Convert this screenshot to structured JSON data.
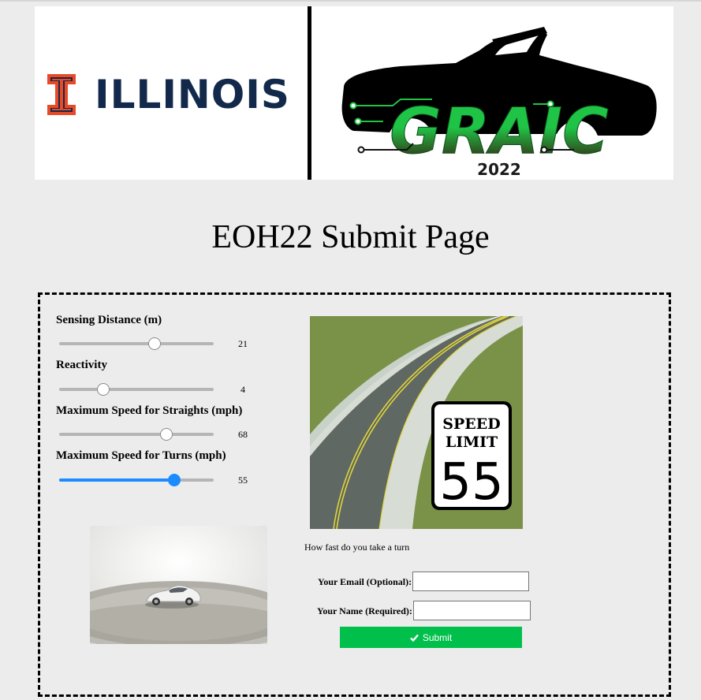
{
  "banner": {
    "university_logo_text": "ILLINOIS",
    "event_logo_text": "GRAIC",
    "event_year": "2022"
  },
  "page": {
    "title": "EOH22 Submit Page"
  },
  "sliders": [
    {
      "label": "Sensing Distance (m)",
      "value": "21",
      "level": 0.61,
      "active": false
    },
    {
      "label": "Reactivity",
      "value": "4",
      "level": 0.28,
      "active": false
    },
    {
      "label": "Maximum Speed for Straights (mph)",
      "value": "68",
      "level": 0.69,
      "active": false
    },
    {
      "label": "Maximum Speed for Turns (mph)",
      "value": "55",
      "level": 0.74,
      "active": true
    }
  ],
  "preview": {
    "sign_line1": "SPEED",
    "sign_line2": "LIMIT",
    "sign_number": "55",
    "caption": "How fast do you take a turn"
  },
  "form": {
    "email_label": "Your Email (Optional):",
    "email_value": "",
    "name_label": "Your Name (Required):",
    "name_value": "",
    "submit_label": "Submit",
    "submit_icon": "check-icon"
  },
  "colors": {
    "illinois_orange": "#e84a27",
    "illinois_blue": "#13294b",
    "graic_green": "#1fc446",
    "submit_green": "#00c04b",
    "slider_active": "#1a8cff"
  }
}
